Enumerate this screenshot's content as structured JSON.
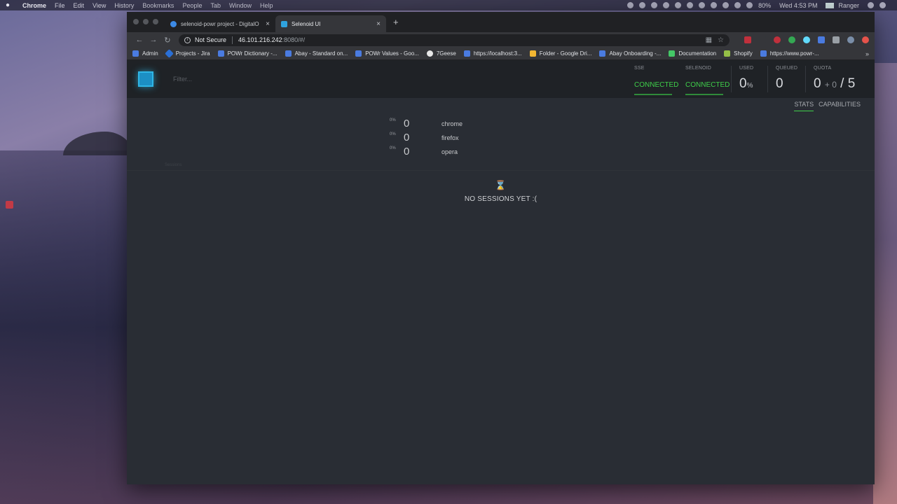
{
  "menubar": {
    "app": "Chrome",
    "items": [
      "File",
      "Edit",
      "View",
      "History",
      "Bookmarks",
      "People",
      "Tab",
      "Window",
      "Help"
    ],
    "battery": "80%",
    "clock": "Wed 4:53 PM",
    "user": "Ranger"
  },
  "tabs": [
    {
      "title": "selenoid-powr project - DigitalO",
      "favicon_color": "#3c8ae6"
    },
    {
      "title": "Selenoid UI",
      "favicon_color": "#2fa3de"
    }
  ],
  "address": {
    "security": "Not Secure",
    "host": "46.101.216.242",
    "rest": ":8080/#/"
  },
  "bookmarks": [
    {
      "label": "Admin",
      "color": "#4a7be0"
    },
    {
      "label": "Projects - Jira",
      "color": "#2a6fd6"
    },
    {
      "label": "POWr Dictionary -...",
      "color": "#4a7be0"
    },
    {
      "label": "Abay - Standard on...",
      "color": "#4a7be0"
    },
    {
      "label": "POWr Values - Goo...",
      "color": "#4a7be0"
    },
    {
      "label": "7Geese",
      "color": "#e8e8e8"
    },
    {
      "label": "https://localhost:3...",
      "color": "#4a7be0"
    },
    {
      "label": "Folder - Google Dri...",
      "color": "#f2b632"
    },
    {
      "label": "Abay Onboarding -...",
      "color": "#4a7be0"
    },
    {
      "label": "Documentation",
      "color": "#44c767"
    },
    {
      "label": "Shopify",
      "color": "#95bf47"
    },
    {
      "label": "https://www.powr-...",
      "color": "#4a7be0"
    }
  ],
  "app": {
    "filter_placeholder": "Filter...",
    "stats": {
      "sse_label": "SSE",
      "sse_value": "CONNECTED",
      "selenoid_label": "SELENOID",
      "selenoid_value": "CONNECTED",
      "used_label": "USED",
      "used_value": "0",
      "used_unit": "%",
      "queued_label": "QUEUED",
      "queued_value": "0",
      "quota_label": "QUOTA",
      "quota_value": "0",
      "quota_plus": "+ 0",
      "quota_total": "/ 5"
    },
    "subnav": {
      "stats": "STATS",
      "capabilities": "CAPABILITIES"
    },
    "browsers": [
      {
        "pct": "0%",
        "count": "0",
        "name": "chrome"
      },
      {
        "pct": "0%",
        "count": "0",
        "name": "firefox"
      },
      {
        "pct": "0%",
        "count": "0",
        "name": "opera"
      }
    ],
    "sessions_label": "Sessions",
    "empty_icon": "hourglass-icon",
    "empty_message": "NO SESSIONS YET :("
  },
  "colors": {
    "connected": "#3fcf4a",
    "accent": "#2fb6e6",
    "background": "#292d34"
  }
}
